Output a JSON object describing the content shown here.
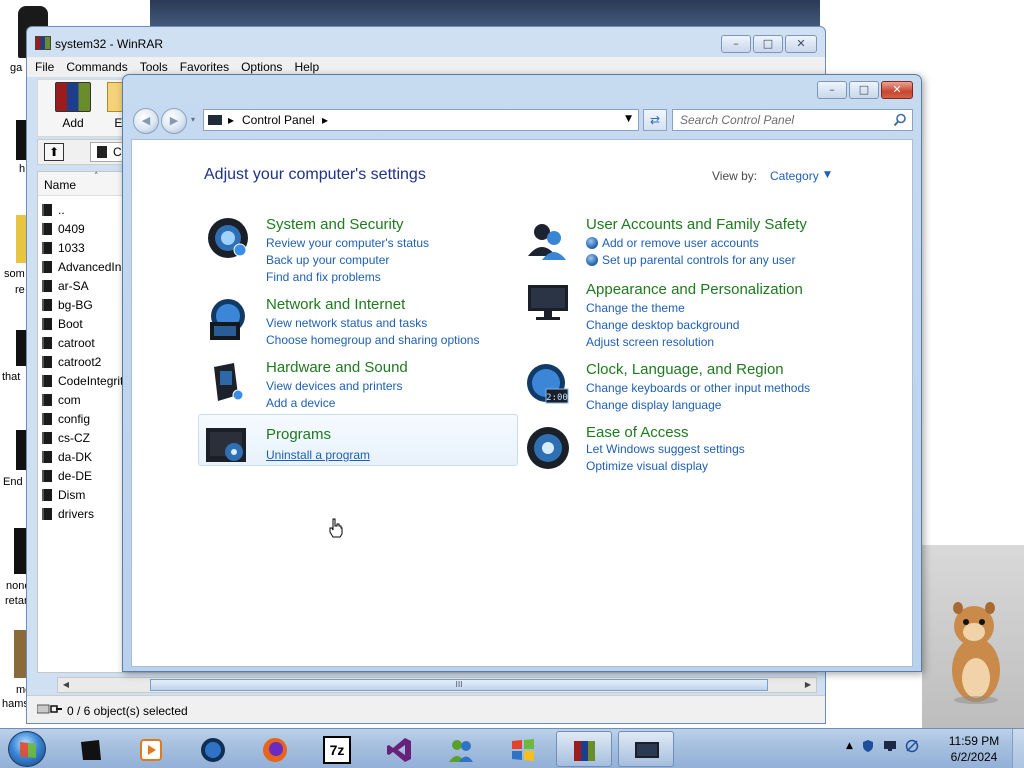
{
  "desktop": {
    "labels": [
      "ga",
      "h",
      "som",
      "re",
      "that",
      "End",
      "none of y",
      "retards kn",
      "mewing",
      "hamster si"
    ]
  },
  "winrar": {
    "title": "system32 - WinRAR",
    "menu": [
      "File",
      "Commands",
      "Tools",
      "Favorites",
      "Options",
      "Help"
    ],
    "toolbar": {
      "add_label": "Add",
      "extract_label": "Extr"
    },
    "path_value": "C",
    "list_header": "Name",
    "files": [
      "..",
      "0409",
      "1033",
      "AdvancedIn",
      "ar-SA",
      "bg-BG",
      "Boot",
      "catroot",
      "catroot2",
      "CodeIntegrit",
      "com",
      "config",
      "cs-CZ",
      "da-DK",
      "de-DE",
      "Dism",
      "drivers"
    ],
    "status_text": "0 / 6 object(s) selected",
    "scroll_thumb": "III"
  },
  "control_panel": {
    "breadcrumb": [
      "Control Panel"
    ],
    "search_placeholder": "Search Control Panel",
    "heading": "Adjust your computer's settings",
    "view_by_label": "View by:",
    "view_by_value": "Category",
    "categories_left": [
      {
        "title": "System and Security",
        "links": [
          "Review your computer's status",
          "Back up your computer",
          "Find and fix problems"
        ]
      },
      {
        "title": "Network and Internet",
        "links": [
          "View network status and tasks",
          "Choose homegroup and sharing options"
        ]
      },
      {
        "title": "Hardware and Sound",
        "links": [
          "View devices and printers",
          "Add a device"
        ]
      },
      {
        "title": "Programs",
        "links": [
          "Uninstall a program"
        ]
      }
    ],
    "categories_right": [
      {
        "title": "User Accounts and Family Safety",
        "links": [
          "Add or remove user accounts",
          "Set up parental controls for any user"
        ]
      },
      {
        "title": "Appearance and Personalization",
        "links": [
          "Change the theme",
          "Change desktop background",
          "Adjust screen resolution"
        ]
      },
      {
        "title": "Clock, Language, and Region",
        "links": [
          "Change keyboards or other input methods",
          "Change display language"
        ]
      },
      {
        "title": "Ease of Access",
        "links": [
          "Let Windows suggest settings",
          "Optimize visual display"
        ]
      }
    ],
    "clock_icon_text": "2:00"
  },
  "taskbar": {
    "apps": [
      "explorer-icon",
      "media-player-icon",
      "globe-icon",
      "firefox-icon",
      "7zip-icon",
      "visual-studio-icon",
      "users-icon",
      "windows-logo-icon",
      "winrar-icon",
      "control-panel-icon"
    ],
    "sevenzip_label": "7z",
    "time": "11:59 PM",
    "date": "6/2/2024"
  },
  "colors": {
    "category_title": "#1e7a1e",
    "link": "#1e5fb3",
    "heading": "#1e3287"
  }
}
